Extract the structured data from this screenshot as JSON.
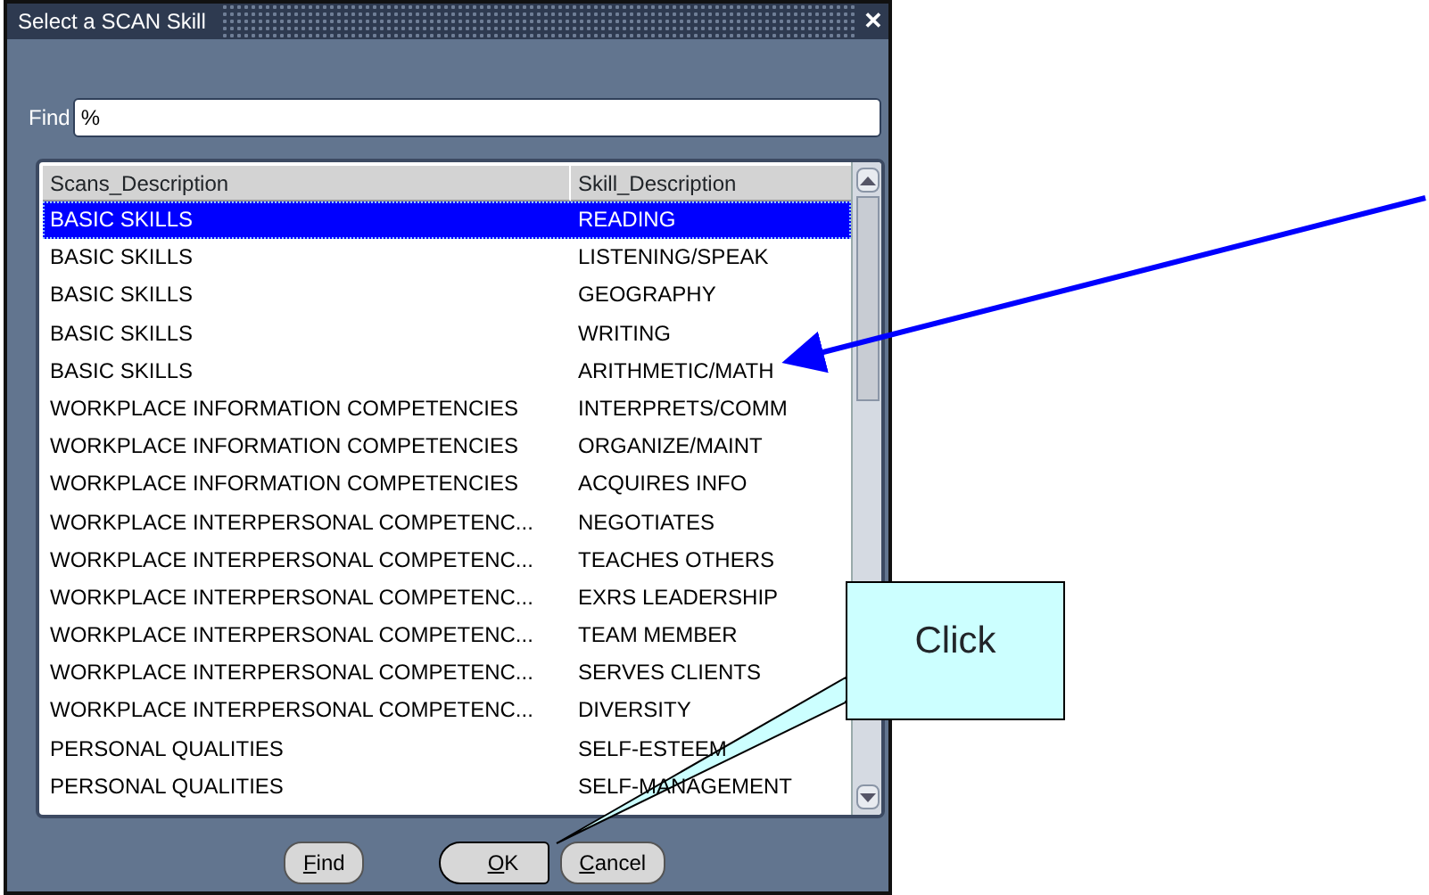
{
  "window": {
    "title": "Select a SCAN Skill",
    "close": "✕"
  },
  "find": {
    "label": "Find",
    "value": "%"
  },
  "table": {
    "columns": [
      "Scans_Description",
      "Skill_Description"
    ],
    "rows": [
      {
        "cells": [
          "BASIC SKILLS",
          "READING"
        ],
        "selected": true
      },
      {
        "cells": [
          "BASIC SKILLS",
          "LISTENING/SPEAK"
        ],
        "selected": false
      },
      {
        "cells": [
          "BASIC SKILLS",
          "GEOGRAPHY"
        ],
        "selected": false
      },
      {
        "cells": [
          "BASIC SKILLS",
          "WRITING"
        ],
        "selected": false
      },
      {
        "cells": [
          "BASIC SKILLS",
          "ARITHMETIC/MATH"
        ],
        "selected": false
      },
      {
        "cells": [
          "WORKPLACE INFORMATION COMPETENCIES",
          "INTERPRETS/COMM"
        ],
        "selected": false
      },
      {
        "cells": [
          "WORKPLACE INFORMATION COMPETENCIES",
          "ORGANIZE/MAINT"
        ],
        "selected": false
      },
      {
        "cells": [
          "WORKPLACE INFORMATION COMPETENCIES",
          "ACQUIRES INFO"
        ],
        "selected": false
      },
      {
        "cells": [
          "WORKPLACE INTERPERSONAL COMPETENC...",
          "NEGOTIATES"
        ],
        "selected": false
      },
      {
        "cells": [
          "WORKPLACE INTERPERSONAL COMPETENC...",
          "TEACHES OTHERS"
        ],
        "selected": false
      },
      {
        "cells": [
          "WORKPLACE INTERPERSONAL COMPETENC...",
          "EXRS LEADERSHIP"
        ],
        "selected": false
      },
      {
        "cells": [
          "WORKPLACE INTERPERSONAL COMPETENC...",
          "TEAM MEMBER"
        ],
        "selected": false
      },
      {
        "cells": [
          "WORKPLACE INTERPERSONAL COMPETENC...",
          "SERVES CLIENTS"
        ],
        "selected": false
      },
      {
        "cells": [
          "WORKPLACE INTERPERSONAL COMPETENC...",
          "DIVERSITY"
        ],
        "selected": false
      },
      {
        "cells": [
          "PERSONAL QUALITIES",
          "SELF-ESTEEM"
        ],
        "selected": false
      },
      {
        "cells": [
          "PERSONAL QUALITIES",
          "SELF-MANAGEMENT"
        ],
        "selected": false
      }
    ]
  },
  "buttons": [
    {
      "label": "Find",
      "default": false
    },
    {
      "label": "OK",
      "default": true
    },
    {
      "label": "Cancel",
      "default": false
    }
  ],
  "callout": {
    "text": "Click"
  }
}
